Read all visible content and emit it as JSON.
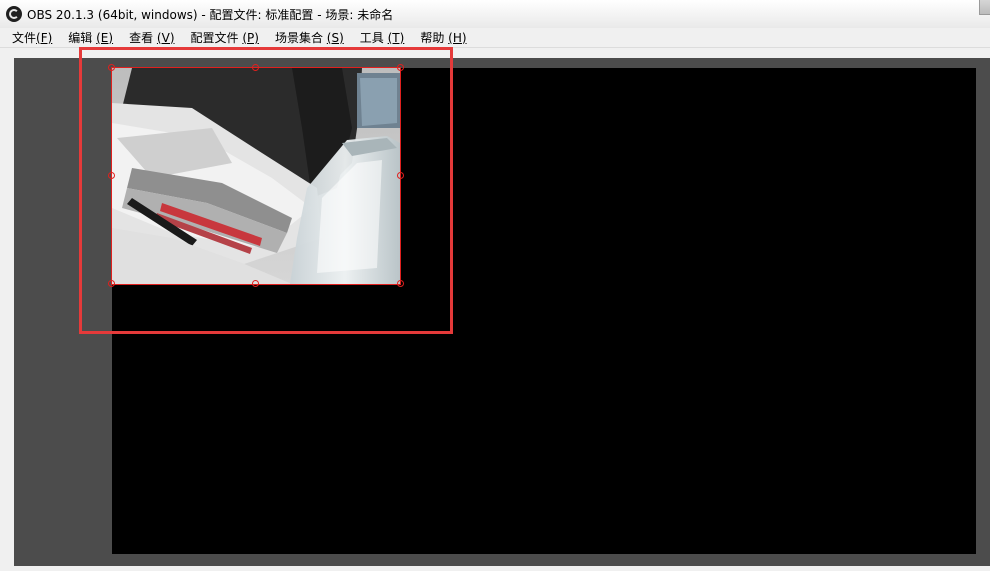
{
  "window": {
    "title": "OBS 20.1.3 (64bit, windows) - 配置文件: 标准配置 - 场景: 未命名",
    "app_icon": "obs-logo-icon"
  },
  "menubar": {
    "items": [
      {
        "label": "文件",
        "accel": "(F)"
      },
      {
        "label": "编辑",
        "accel": "(E)"
      },
      {
        "label": "查看",
        "accel": "(V)"
      },
      {
        "label": "配置文件",
        "accel": "(P)"
      },
      {
        "label": "场景集合",
        "accel": "(S)"
      },
      {
        "label": "工具",
        "accel": "(T)"
      },
      {
        "label": "帮助",
        "accel": "(H)"
      }
    ]
  },
  "colors": {
    "selection_outline": "#e0201e",
    "annotation_box": "#e53a3a",
    "canvas_background": "#000000",
    "preview_background": "#4c4c4c"
  }
}
